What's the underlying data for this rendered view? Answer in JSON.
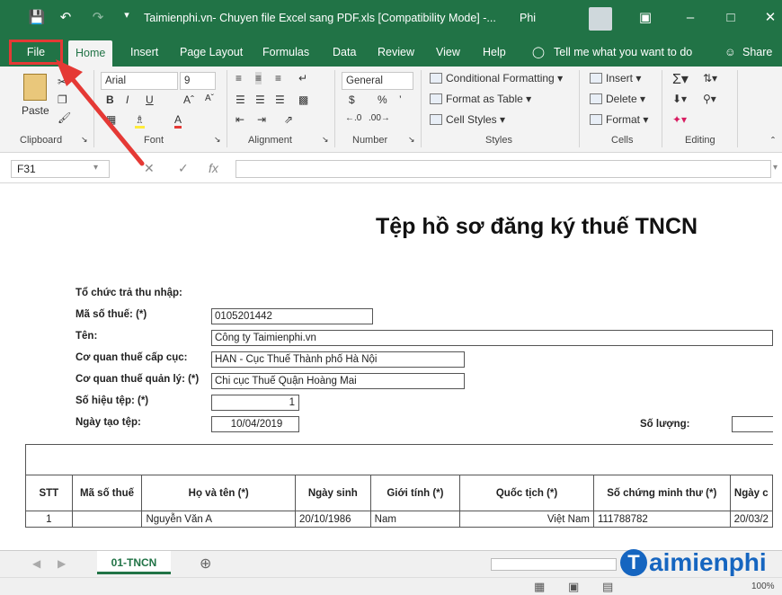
{
  "window": {
    "title": "Taimienphi.vn- Chuyen file Excel sang PDF.xls [Compatibility Mode] -...",
    "user": "Phi"
  },
  "tabs": [
    "Home",
    "Insert",
    "Page Layout",
    "Formulas",
    "Data",
    "Review",
    "View",
    "Help"
  ],
  "file_tab": "File",
  "tell_me": "Tell me what you want to do",
  "share": "Share",
  "ribbon": {
    "clipboard": {
      "paste": "Paste",
      "label": "Clipboard"
    },
    "font": {
      "name": "Arial",
      "size": "9",
      "label": "Font",
      "bold": "B",
      "italic": "I",
      "underline": "U"
    },
    "alignment": {
      "label": "Alignment"
    },
    "number": {
      "format": "General",
      "currency": "$",
      "percent": "%",
      "label": "Number"
    },
    "styles": {
      "conditional": "Conditional Formatting",
      "table": "Format as Table",
      "cell": "Cell Styles",
      "label": "Styles"
    },
    "cells": {
      "insert": "Insert",
      "delete": "Delete",
      "format": "Format",
      "label": "Cells"
    },
    "editing": {
      "label": "Editing"
    }
  },
  "formula_bar": {
    "cell": "F31",
    "fx": "fx"
  },
  "sheet": {
    "title": "Tệp hồ sơ đăng ký thuế TNCN",
    "labels": {
      "org": "Tổ chức trả thu nhập:",
      "tax_code": "Mã số thuế: (*)",
      "name": "Tên:",
      "agency_level": "Cơ quan thuế cấp cục:",
      "agency_mgmt": "Cơ quan thuế quản lý: (*)",
      "file_no": "Số hiệu tệp: (*)",
      "created": "Ngày tạo tệp:",
      "quantity": "Số lượng:"
    },
    "values": {
      "tax_code": "0105201442",
      "name": "Công ty Taimienphi.vn",
      "agency_level": "HAN - Cục Thuế Thành phố Hà Nội",
      "agency_mgmt": "Chi cục Thuế Quận Hoàng Mai",
      "file_no": "1",
      "created": "10/04/2019"
    },
    "table": {
      "headers": [
        "STT",
        "Mã số thuế",
        "Họ và tên (*)",
        "Ngày sinh",
        "Giới tính (*)",
        "Quốc tịch (*)",
        "Số chứng minh thư (*)",
        "Ngày c"
      ],
      "rows": [
        [
          "1",
          "",
          "Nguyễn Văn A",
          "20/10/1986",
          "Nam",
          "Việt Nam",
          "111788782",
          "20/03/2"
        ]
      ]
    }
  },
  "sheet_tab": "01-TNCN",
  "watermark": {
    "logo": "T",
    "text": "aimienphi"
  },
  "status": {
    "zoom": "100%"
  }
}
